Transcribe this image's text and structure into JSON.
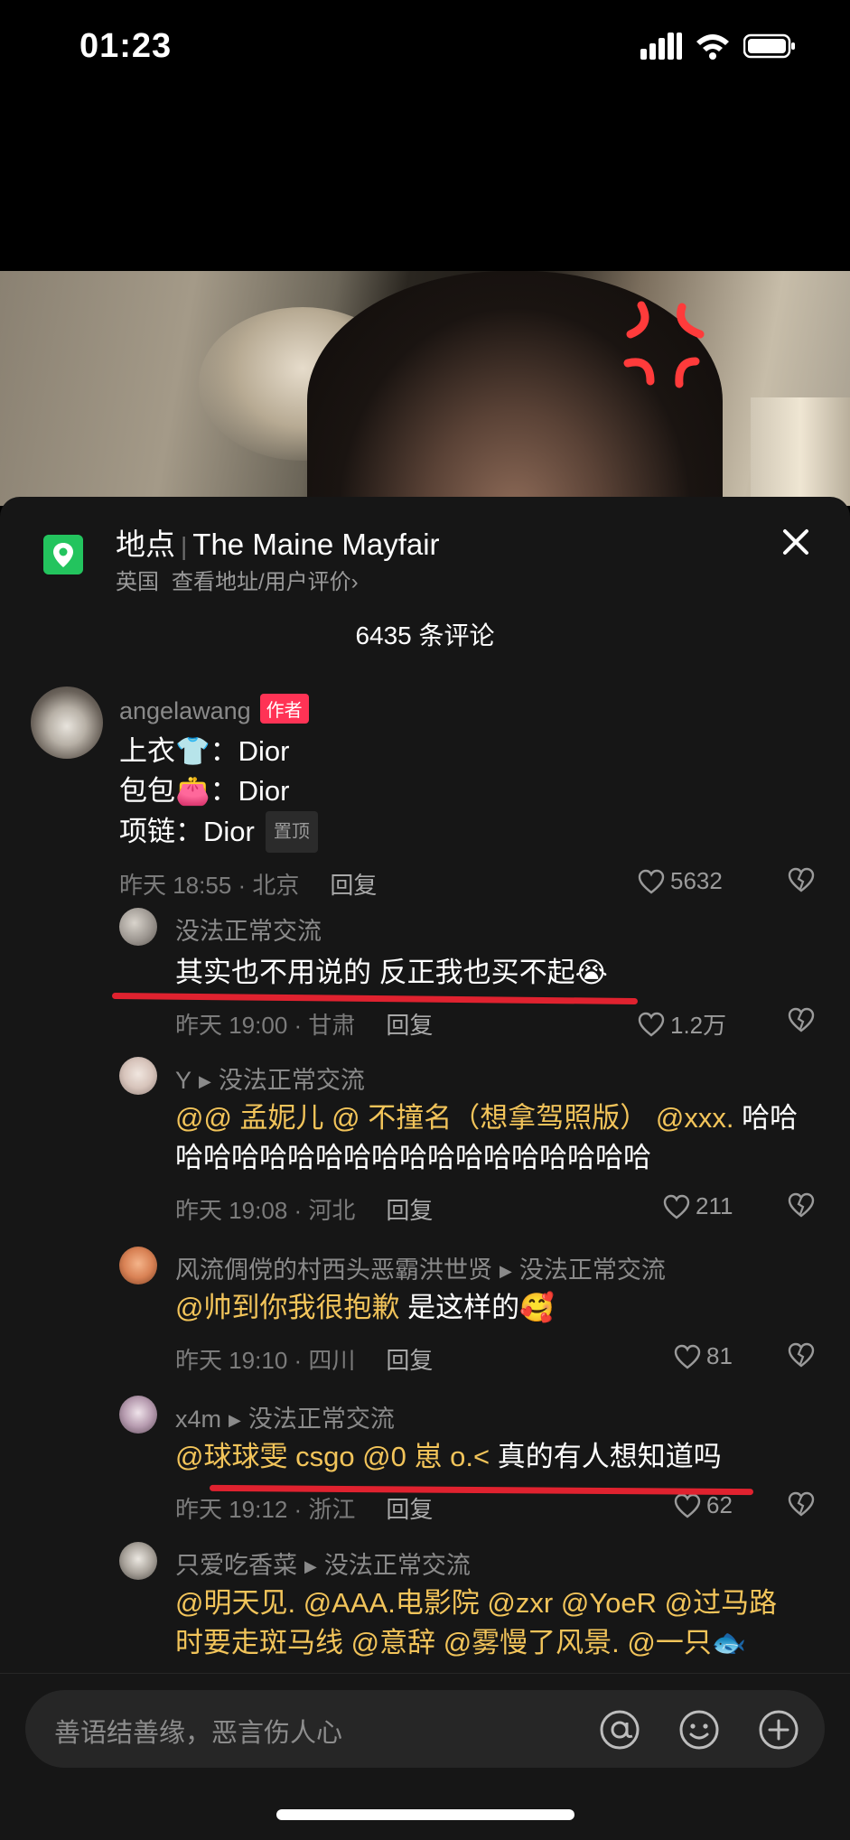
{
  "status_bar": {
    "time": "01:23"
  },
  "location": {
    "label": "地点",
    "name": "The Maine Mayfair",
    "country": "英国",
    "link": "查看地址/用户评价",
    "chevron": "›"
  },
  "comment_count": "6435 条评论",
  "comments": [
    {
      "author": "angelawang",
      "badge": "作者",
      "lines": [
        {
          "label": "上衣",
          "emoji": "👕",
          "sep": "：",
          "value": "Dior"
        },
        {
          "label": "包包",
          "emoji": "👛",
          "sep": "：",
          "value": "Dior"
        },
        {
          "label": "项链",
          "emoji": "",
          "sep": "：",
          "value": "Dior"
        }
      ],
      "pin": "置顶",
      "time": "昨天 18:55 · 北京",
      "reply": "回复",
      "likes": "5632"
    },
    {
      "author": "没法正常交流",
      "text": "其实也不用说的 反正我也买不起😭",
      "time": "昨天 19:00 · 甘肃",
      "reply": "回复",
      "likes": "1.2万"
    },
    {
      "author": "Y",
      "reply_to": "没法正常交流",
      "mentions1": "@@ 孟妮儿 @ 不撞名（想拿驾照版） @xxx.",
      "text1": " 哈哈",
      "text2": "哈哈哈哈哈哈哈哈哈哈哈哈哈哈哈哈哈",
      "time": "昨天 19:08 · 河北",
      "reply": "回复",
      "likes": "211"
    },
    {
      "author": "风流倜傥的村西头恶霸洪世贤",
      "reply_to": "没法正常交流",
      "mention": "@帅到你我很抱歉",
      "text": " 是这样的🥰",
      "time": "昨天 19:10 · 四川",
      "reply": "回复",
      "likes": "81"
    },
    {
      "author": "x4m",
      "reply_to": "没法正常交流",
      "mention": "@球球雯 csgo @0 崽 o.<",
      "text": " 真的有人想知道吗",
      "time": "昨天 19:12 · 浙江",
      "reply": "回复",
      "likes": "62"
    },
    {
      "author": "只爱吃香菜",
      "reply_to": "没法正常交流",
      "line1": "@明天见. @AAA.电影院 @zxr @YoeR @过马路",
      "line2": "时要走斑马线 @意辞 @雾慢了风景. @一只🐟"
    }
  ],
  "input": {
    "placeholder": "善语结善缘，恶言伤人心"
  },
  "colors": {
    "panel": "#161616",
    "mention": "#f2c45a",
    "badge": "#ff3355",
    "underline": "#e0222f",
    "location_icon": "#23c45e"
  }
}
